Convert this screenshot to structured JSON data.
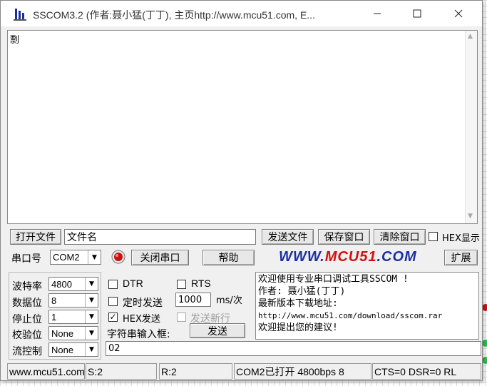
{
  "window": {
    "title": "SSCOM3.2 (作者:聂小猛(丁丁), 主页http://www.mcu51.com,  E..."
  },
  "receive": {
    "text": "剽"
  },
  "file_row": {
    "open_file": "打开文件",
    "file_name": "文件名",
    "send_file": "发送文件",
    "save_window": "保存窗口",
    "clear_window": "清除窗口",
    "hex_display": "HEX显示"
  },
  "port_row": {
    "port_label": "串口号",
    "port_value": "COM2",
    "close_port": "关闭串口",
    "help": "帮助",
    "brand_a": "WWW.",
    "brand_b": "MCU51",
    "brand_c": ".COM",
    "expand": "扩展"
  },
  "settings": {
    "baud_label": "波特率",
    "baud_value": "4800",
    "data_label": "数据位",
    "data_value": "8",
    "stop_label": "停止位",
    "stop_value": "1",
    "parity_label": "校验位",
    "parity_value": "None",
    "flow_label": "流控制",
    "flow_value": "None"
  },
  "options": {
    "dtr": "DTR",
    "rts": "RTS",
    "timed_send": "定时发送",
    "interval": "1000",
    "interval_unit": "ms/次",
    "hex_send": "HEX发送",
    "send_newline": "发送新行",
    "input_label": "字符串输入框:",
    "send": "发送",
    "input_value": "02"
  },
  "info": {
    "line1": "欢迎使用专业串口调试工具SSCOM !",
    "line2": "作者: 聂小猛(丁丁)",
    "line3": "最新版本下载地址:",
    "line4": "http://www.mcu51.com/download/sscom.rar",
    "line5": "欢迎提出您的建议!"
  },
  "statusbar": {
    "site": "www.mcu51.com",
    "sent": "S:2",
    "received": "R:2",
    "port_status": "COM2已打开  4800bps  8",
    "lines": "CTS=0 DSR=0 RL"
  },
  "colors": {
    "brand_blue": "#1c2fa5",
    "brand_red": "#d20f0f",
    "led_red": "#cc1111"
  }
}
